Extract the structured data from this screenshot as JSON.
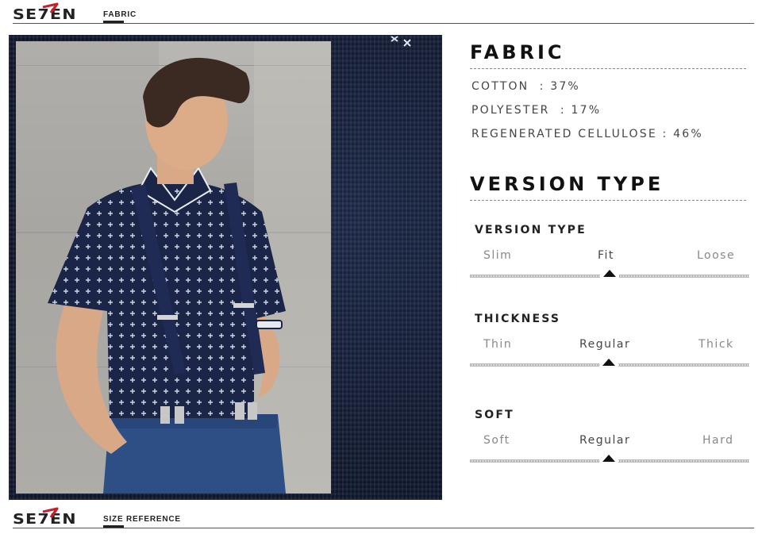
{
  "top_bar": {
    "logo": "SE7EN",
    "tag": "FABRIC"
  },
  "fabric": {
    "heading": "FABRIC",
    "lines": [
      "COTTON  : 37%",
      "POLYESTER  : 17%",
      "REGENERATED CELLULOSE : 46%"
    ]
  },
  "version_heading": "VERSION TYPE",
  "scales": [
    {
      "title": "VERSION TYPE",
      "options": [
        "Slim",
        "Fit",
        "Loose"
      ],
      "selected_index": 1
    },
    {
      "title": "THICKNESS",
      "options": [
        "Thin",
        "Regular",
        "Thick"
      ],
      "selected_index": 1
    },
    {
      "title": "SOFT",
      "options": [
        "Soft",
        "Regular",
        "Hard"
      ],
      "selected_index": 1
    }
  ],
  "bottom_bar": {
    "logo": "SE7EN",
    "tag": "SIZE REFERENCE"
  },
  "colors": {
    "accent_red": "#c8202b",
    "navy": "#18233f",
    "text_dark": "#111111"
  }
}
